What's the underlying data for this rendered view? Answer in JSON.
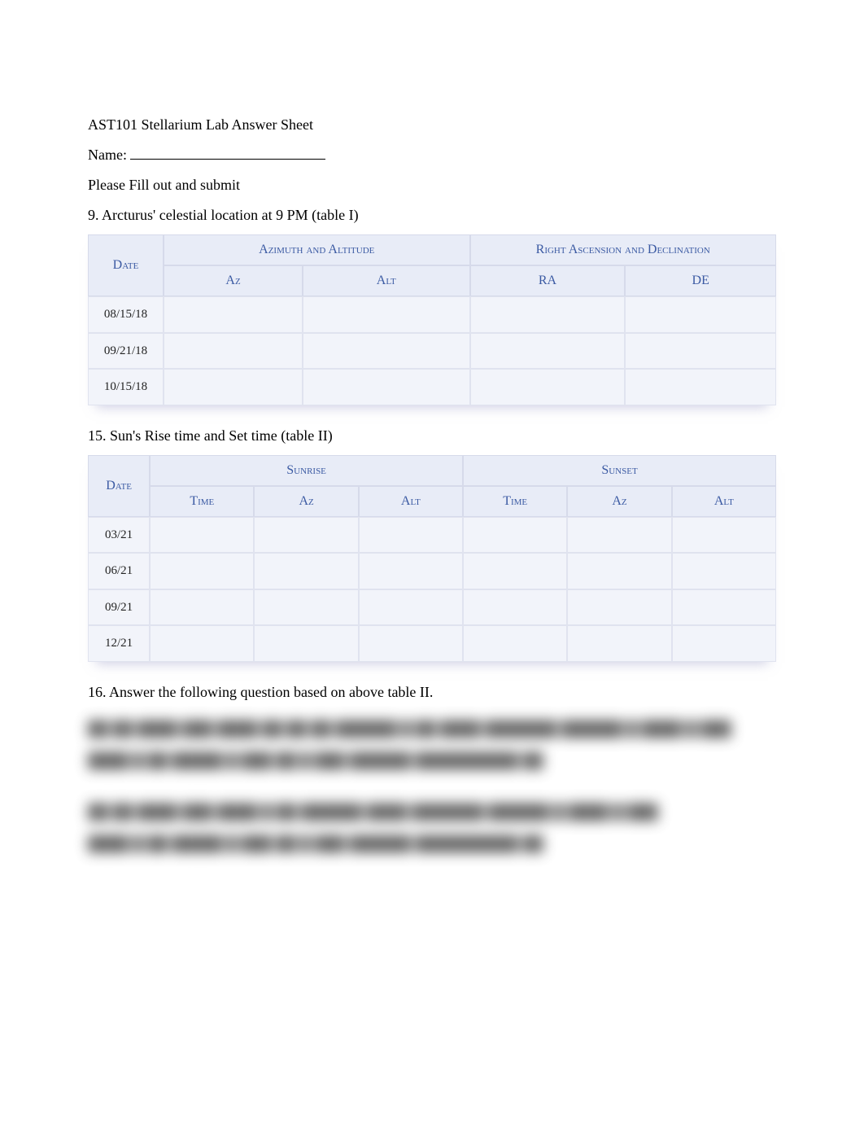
{
  "title": "AST101 Stellarium Lab Answer Sheet",
  "name_label": "Name:",
  "instruction": "Please Fill out and submit",
  "q9": "9. Arcturus' celestial location at 9 PM (table I)",
  "table1": {
    "h_date": "Date",
    "h_azalt": "Azimuth and Altitude",
    "h_radec": "Right Ascension and Declination",
    "h_az": "Az",
    "h_alt": "Alt",
    "h_ra": "RA",
    "h_de": "DE",
    "rows": [
      {
        "date": "08/15/18",
        "az": "",
        "alt": "",
        "ra": "",
        "de": ""
      },
      {
        "date": "09/21/18",
        "az": "",
        "alt": "",
        "ra": "",
        "de": ""
      },
      {
        "date": "10/15/18",
        "az": "",
        "alt": "",
        "ra": "",
        "de": ""
      }
    ]
  },
  "q15": "15. Sun's Rise time and Set time (table II)",
  "table2": {
    "h_date": "Date",
    "h_sunrise": "Sunrise",
    "h_sunset": "Sunset",
    "h_time": "Time",
    "h_az": "Az",
    "h_alt": "Alt",
    "rows": [
      {
        "date": "03/21",
        "sr_time": "",
        "sr_az": "",
        "sr_alt": "",
        "ss_time": "",
        "ss_az": "",
        "ss_alt": ""
      },
      {
        "date": "06/21",
        "sr_time": "",
        "sr_az": "",
        "sr_alt": "",
        "ss_time": "",
        "ss_az": "",
        "ss_alt": ""
      },
      {
        "date": "09/21",
        "sr_time": "",
        "sr_az": "",
        "sr_alt": "",
        "ss_time": "",
        "ss_az": "",
        "ss_alt": ""
      },
      {
        "date": "12/21",
        "sr_time": "",
        "sr_az": "",
        "sr_alt": "",
        "ss_time": "",
        "ss_az": "",
        "ss_alt": ""
      }
    ]
  },
  "q16": "16. Answer the following question based on above table II."
}
